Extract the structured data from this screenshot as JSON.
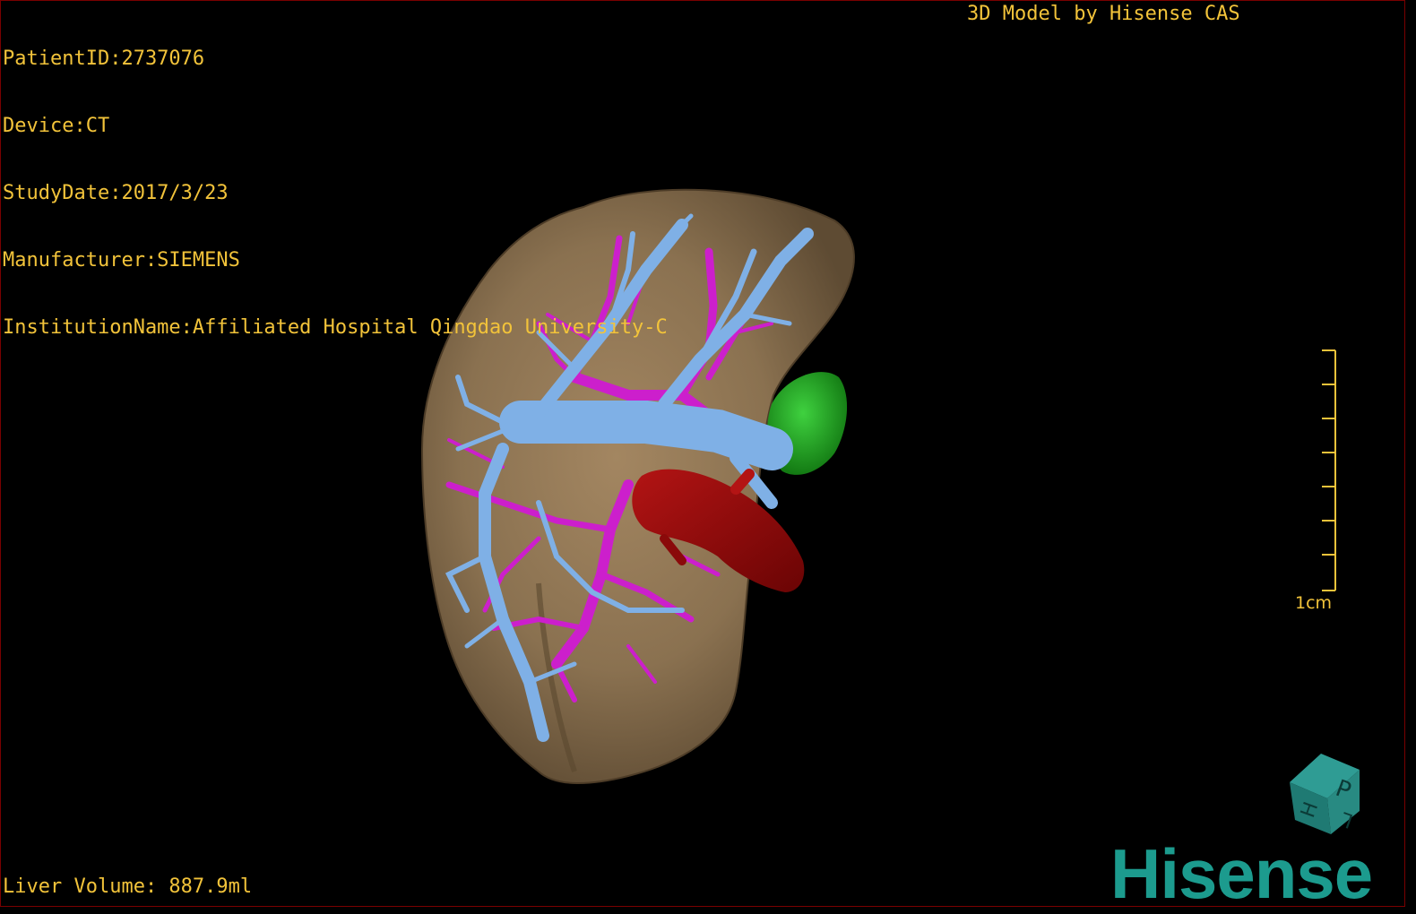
{
  "info": {
    "patient_id": "PatientID:2737076",
    "device": "Device:CT",
    "study_date": "StudyDate:2017/3/23",
    "manufacturer": "Manufacturer:SIEMENS",
    "institution": "InstitutionName:Affiliated Hospital Qingdao University-C"
  },
  "credit": "3D Model by Hisense CAS",
  "volume": "Liver Volume: 887.9ml",
  "scale": {
    "label": "1cm"
  },
  "orientation_cube": {
    "faces": [
      "P",
      "H",
      "L"
    ]
  },
  "logo": "Hisense",
  "colors": {
    "overlay_text": "#f2c33a",
    "liver": "#8a7150",
    "portal_vein": "#7fb0e6",
    "hepatic_vein": "#cc1fcc",
    "ivc": "#9a0a0a",
    "gallbladder": "#1fa51f",
    "logo": "#1c9b8e"
  }
}
